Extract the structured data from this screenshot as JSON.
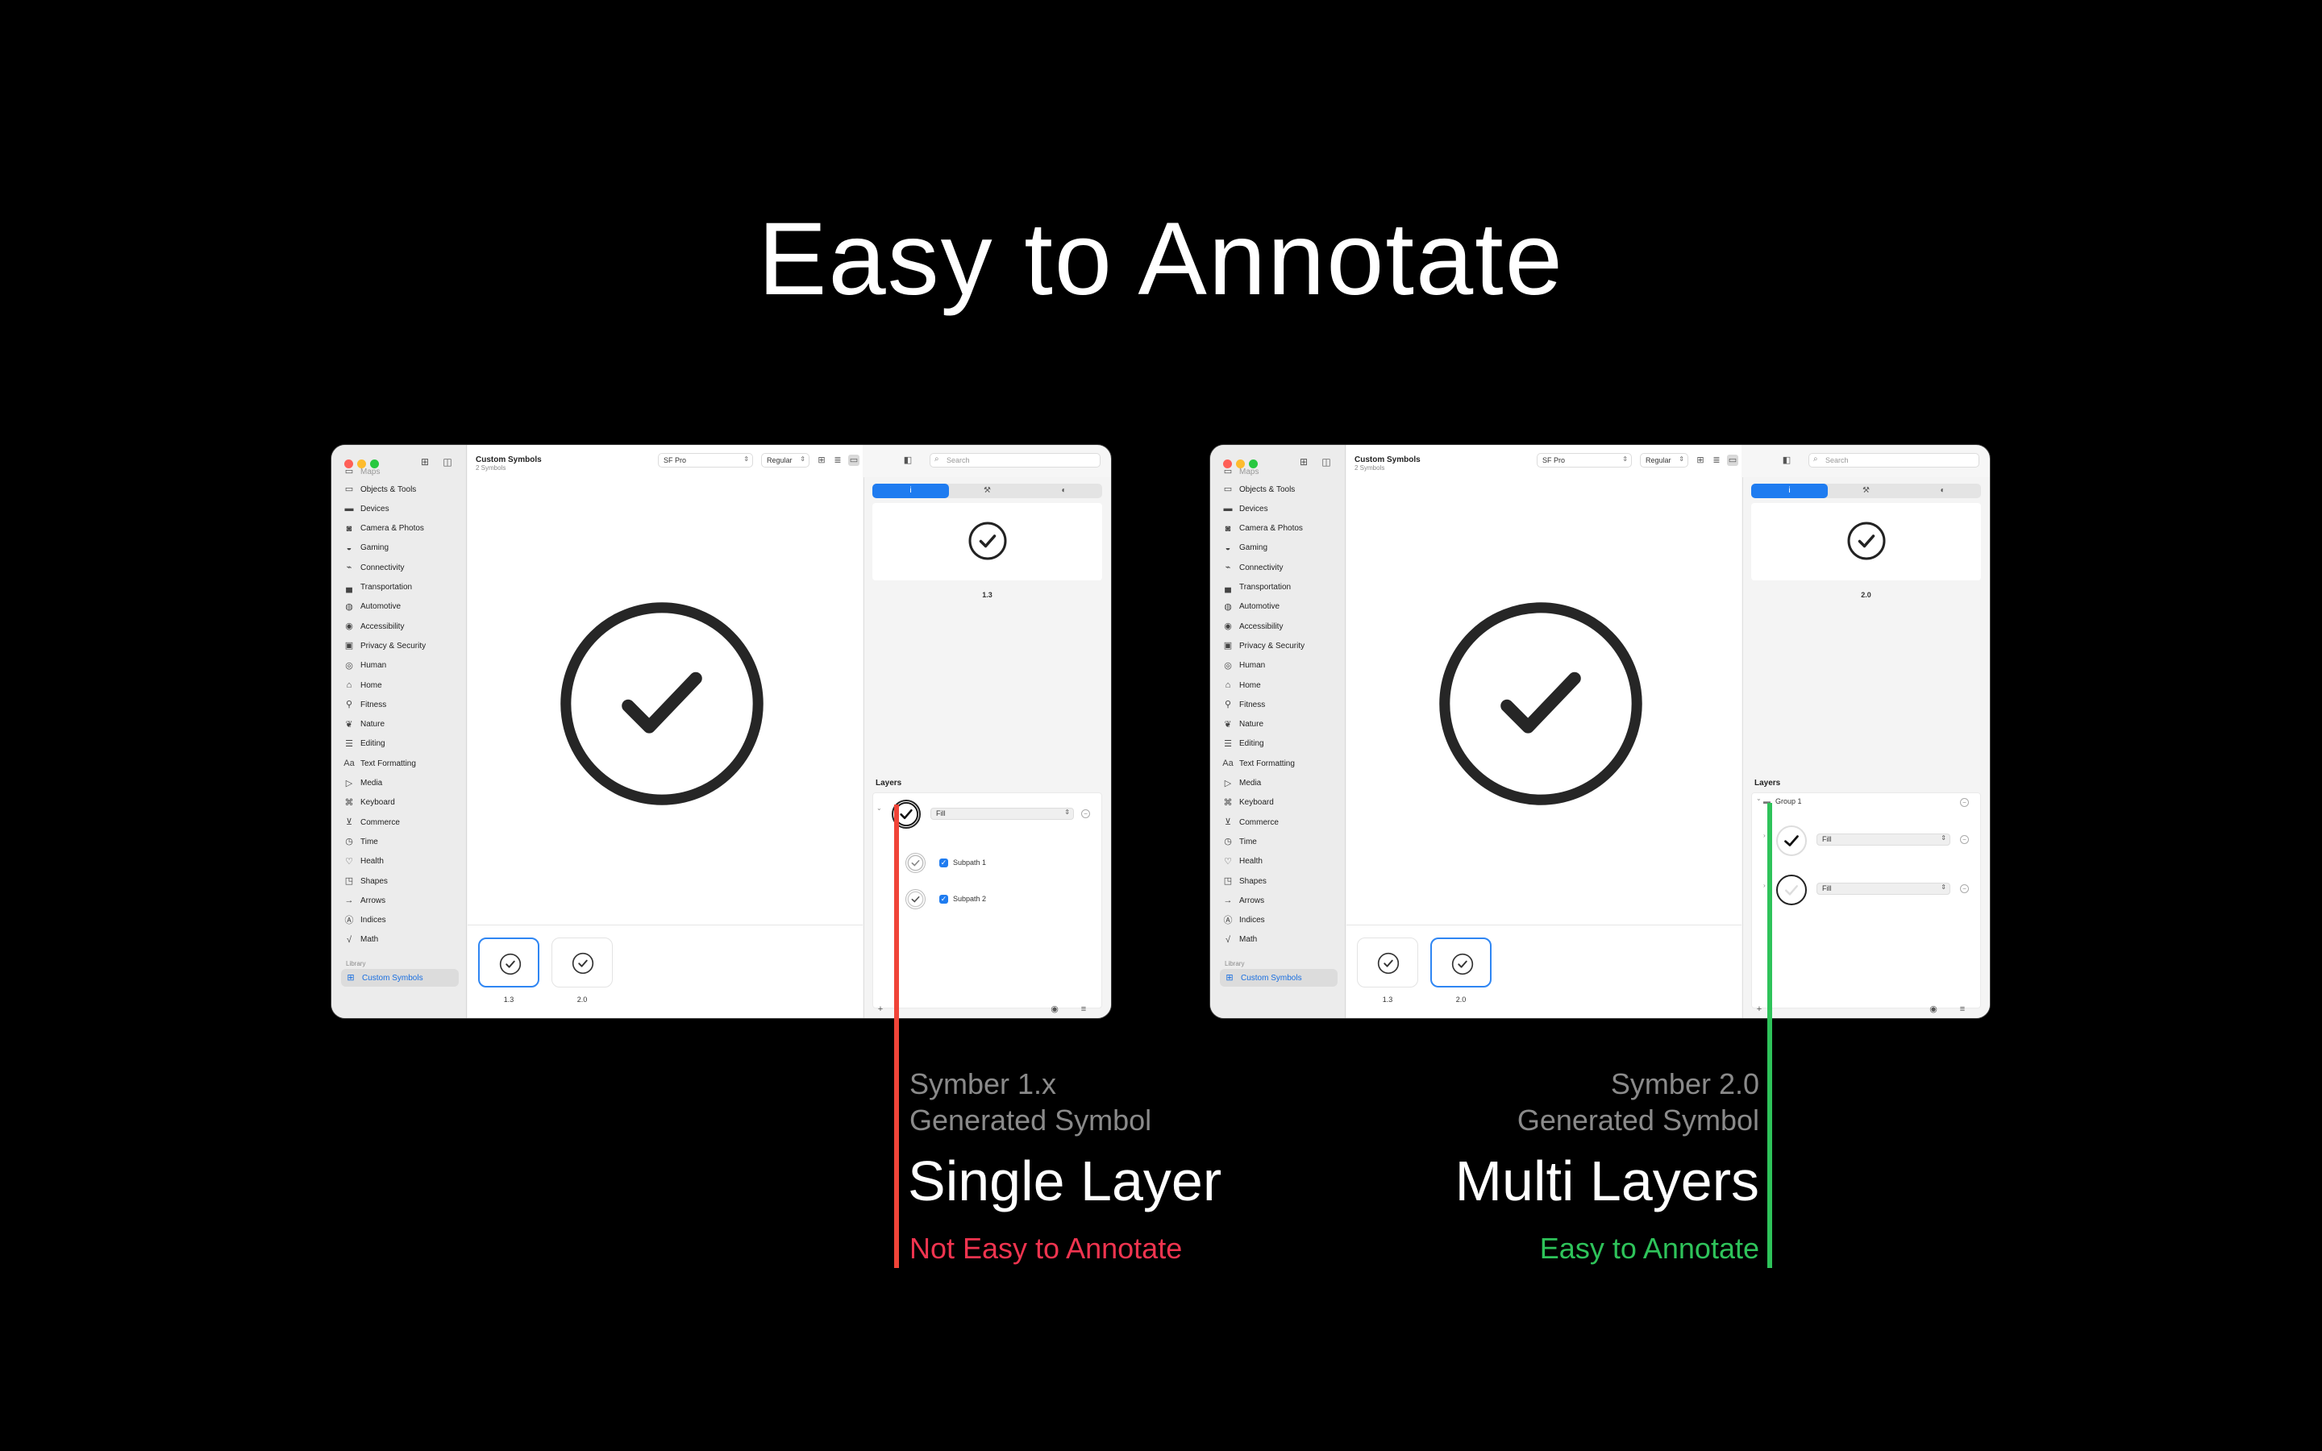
{
  "title": "Easy to Annotate",
  "colors": {
    "accent_blue": "#1f7cf0",
    "annotation_red": "#f04438",
    "annotation_green": "#2ec35a",
    "bad_text": "#f0344f"
  },
  "sidebar": {
    "faded_top": "Maps",
    "items": [
      {
        "label": "Objects & Tools",
        "icon": "folder-icon"
      },
      {
        "label": "Devices",
        "icon": "display-icon"
      },
      {
        "label": "Camera & Photos",
        "icon": "camera-icon"
      },
      {
        "label": "Gaming",
        "icon": "gamecontroller-icon"
      },
      {
        "label": "Connectivity",
        "icon": "antenna-icon"
      },
      {
        "label": "Transportation",
        "icon": "car-icon"
      },
      {
        "label": "Automotive",
        "icon": "steering-wheel-icon"
      },
      {
        "label": "Accessibility",
        "icon": "accessibility-icon"
      },
      {
        "label": "Privacy & Security",
        "icon": "lock-icon"
      },
      {
        "label": "Human",
        "icon": "person-icon"
      },
      {
        "label": "Home",
        "icon": "house-icon"
      },
      {
        "label": "Fitness",
        "icon": "figure-run-icon"
      },
      {
        "label": "Nature",
        "icon": "leaf-icon"
      },
      {
        "label": "Editing",
        "icon": "slider-icon"
      },
      {
        "label": "Text Formatting",
        "icon": "textformat-icon"
      },
      {
        "label": "Media",
        "icon": "playpause-icon"
      },
      {
        "label": "Keyboard",
        "icon": "command-icon"
      },
      {
        "label": "Commerce",
        "icon": "cart-icon"
      },
      {
        "label": "Time",
        "icon": "clock-icon"
      },
      {
        "label": "Health",
        "icon": "heart-icon"
      },
      {
        "label": "Shapes",
        "icon": "square-on-circle-icon"
      },
      {
        "label": "Arrows",
        "icon": "arrow-right-icon"
      },
      {
        "label": "Indices",
        "icon": "a-circle-icon"
      },
      {
        "label": "Math",
        "icon": "x-squareroot-icon"
      }
    ],
    "library_section": "Library",
    "library_item": "Custom Symbols"
  },
  "toolbar": {
    "doc_title": "Custom Symbols",
    "doc_subtitle": "2 Symbols",
    "font_select": "SF Pro",
    "weight_select": "Regular",
    "search_placeholder": "Search"
  },
  "thumbnails": [
    {
      "label": "1.3"
    },
    {
      "label": "2.0"
    }
  ],
  "inspector": {
    "tab_info": "i",
    "tab_edit": "⚒",
    "tab_more": "◐",
    "layers_title": "Layers",
    "fill_label": "Fill"
  },
  "left_window": {
    "version": "1.3",
    "selected_thumb": 0,
    "layers": {
      "subpath1": "Subpath 1",
      "subpath2": "Subpath 2"
    }
  },
  "right_window": {
    "version": "2.0",
    "selected_thumb": 1,
    "layers": {
      "group": "Group 1"
    }
  },
  "captions": {
    "left": {
      "line1": "Symber 1.x",
      "line2": "Generated Symbol",
      "headline": "Single Layer",
      "verdict": "Not Easy to Annotate"
    },
    "right": {
      "line1": "Symber 2.0",
      "line2": "Generated Symbol",
      "headline": "Multi Layers",
      "verdict": "Easy to Annotate"
    }
  }
}
